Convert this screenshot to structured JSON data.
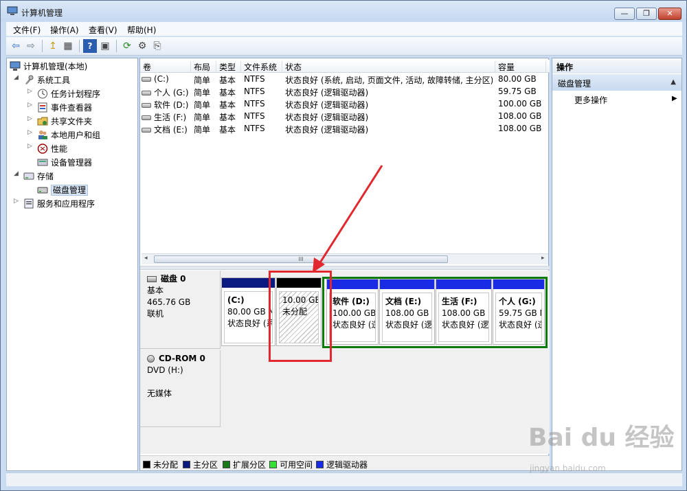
{
  "window": {
    "title": "计算机管理",
    "min_label": "—",
    "max_label": "❐",
    "close_label": "✕"
  },
  "menu": [
    "文件(F)",
    "操作(A)",
    "查看(V)",
    "帮助(H)"
  ],
  "toolbar": {
    "back_glyph": "⇦",
    "forward_glyph": "⇨",
    "up_glyph": "↥",
    "grid_glyph": "▦",
    "help_glyph": "?",
    "panel_glyph": "▣",
    "refresh_glyph": "⟳",
    "props_glyph": "⚙",
    "export_glyph": "⎘"
  },
  "tree": {
    "root": "计算机管理(本地)",
    "system_tools": "系统工具",
    "task_scheduler": "任务计划程序",
    "event_viewer": "事件查看器",
    "shared_folders": "共享文件夹",
    "local_users": "本地用户和组",
    "performance": "性能",
    "device_manager": "设备管理器",
    "storage": "存储",
    "disk_management": "磁盘管理",
    "services_apps": "服务和应用程序"
  },
  "volume_list": {
    "columns": [
      "卷",
      "布局",
      "类型",
      "文件系统",
      "状态",
      "容量"
    ],
    "rows": [
      {
        "volume": "(C:)",
        "layout": "简单",
        "type": "基本",
        "fs": "NTFS",
        "status": "状态良好 (系统, 启动, 页面文件, 活动, 故障转储, 主分区)",
        "capacity": "80.00 GB"
      },
      {
        "volume": "个人 (G:)",
        "layout": "简单",
        "type": "基本",
        "fs": "NTFS",
        "status": "状态良好 (逻辑驱动器)",
        "capacity": "59.75 GB"
      },
      {
        "volume": "软件 (D:)",
        "layout": "简单",
        "type": "基本",
        "fs": "NTFS",
        "status": "状态良好 (逻辑驱动器)",
        "capacity": "100.00 GB"
      },
      {
        "volume": "生活 (F:)",
        "layout": "简单",
        "type": "基本",
        "fs": "NTFS",
        "status": "状态良好 (逻辑驱动器)",
        "capacity": "108.00 GB"
      },
      {
        "volume": "文档 (E:)",
        "layout": "简单",
        "type": "基本",
        "fs": "NTFS",
        "status": "状态良好 (逻辑驱动器)",
        "capacity": "108.00 GB"
      }
    ],
    "scroll_grip": "III"
  },
  "disk0": {
    "name": "磁盘 0",
    "kind": "基本",
    "size": "465.76 GB",
    "state": "联机",
    "partitions": [
      {
        "name": "(C:)",
        "size": "80.00 GB N",
        "status": "状态良好 (系",
        "bar": "#0a1a80"
      },
      {
        "name": "",
        "size": "10.00 GB",
        "status": "未分配",
        "bar": "#000000"
      },
      {
        "name": "软件 (D:)",
        "size": "100.00 GB",
        "status": "状态良好 (逻",
        "bar": "#1a2be6"
      },
      {
        "name": "文档 (E:)",
        "size": "108.00 GB N",
        "status": "状态良好 (逻",
        "bar": "#1a2be6"
      },
      {
        "name": "生活 (F:)",
        "size": "108.00 GB N",
        "status": "状态良好 (逻",
        "bar": "#1a2be6"
      },
      {
        "name": "个人 (G:)",
        "size": "59.75 GB N",
        "status": "状态良好 (逻",
        "bar": "#1a2be6"
      }
    ]
  },
  "cdrom": {
    "name": "CD-ROM 0",
    "drive": "DVD (H:)",
    "media": "无媒体"
  },
  "legend": [
    {
      "label": "未分配",
      "color": "#000000"
    },
    {
      "label": "主分区",
      "color": "#0a1a80"
    },
    {
      "label": "扩展分区",
      "color": "#1a7a1a"
    },
    {
      "label": "可用空间",
      "color": "#33e033"
    },
    {
      "label": "逻辑驱动器",
      "color": "#1a2be6"
    }
  ],
  "actions": {
    "header": "操作",
    "selected": "磁盘管理",
    "more": "更多操作"
  },
  "watermark": {
    "text": "Bai du 经验",
    "sub": "jingyan.baidu.com"
  }
}
